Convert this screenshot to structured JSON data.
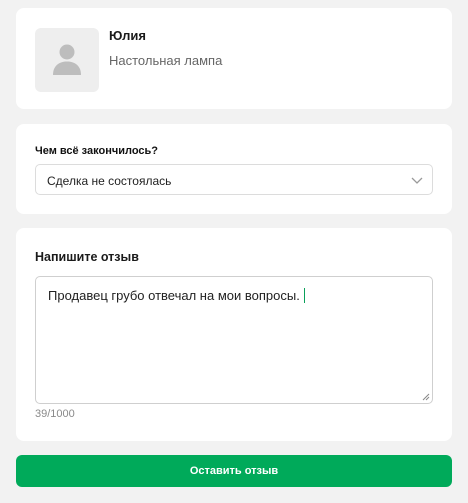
{
  "seller": {
    "name": "Юлия",
    "item": "Настольная лампа",
    "avatar_icon": "user-silhouette-icon"
  },
  "outcome": {
    "label": "Чем всё закончилось?",
    "selected": "Сделка не состоялась",
    "dropdown_icon": "chevron-down-icon"
  },
  "review": {
    "title": "Напишите отзыв",
    "text": "Продавец грубо отвечал на мои вопросы.",
    "counter": "39/1000"
  },
  "submit": {
    "label": "Оставить отзыв"
  },
  "colors": {
    "accent": "#00aa5a",
    "background": "#f2f2f2",
    "card": "#ffffff"
  }
}
